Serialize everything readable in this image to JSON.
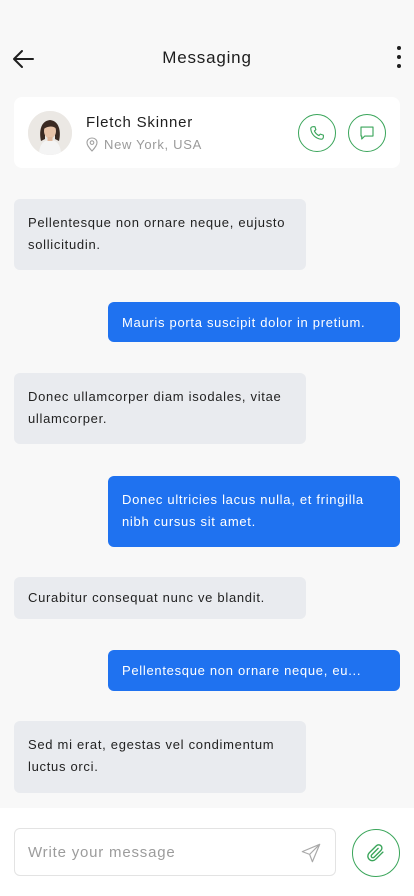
{
  "header": {
    "title": "Messaging"
  },
  "contact": {
    "name": "Fletch Skinner",
    "location": "New York, USA"
  },
  "messages": [
    {
      "direction": "in",
      "text": "Pellentesque non ornare neque, eujusto sollicitudin."
    },
    {
      "direction": "out",
      "text": "Mauris porta suscipit dolor in pretium."
    },
    {
      "direction": "in",
      "text": "Donec ullamcorper diam isodales, vitae ullamcorper."
    },
    {
      "direction": "out",
      "text": "Donec ultricies lacus nulla, et fringilla nibh cursus sit amet."
    },
    {
      "direction": "in",
      "text": "Curabitur consequat nunc ve  blandit."
    },
    {
      "direction": "out",
      "text": "Pellentesque non ornare neque, eu..."
    },
    {
      "direction": "in",
      "text": "Sed mi erat, egestas vel condimentum luctus orci."
    }
  ],
  "composer": {
    "placeholder": "Write your message",
    "value": ""
  },
  "colors": {
    "accent_green": "#3aa55a",
    "outgoing_bubble": "#1f72f0",
    "incoming_bubble": "#e9ebef"
  },
  "icons": {
    "back": "arrow-left-icon",
    "more": "more-vertical-icon",
    "location": "map-pin-icon",
    "call": "phone-icon",
    "chat": "chat-bubble-icon",
    "send": "send-icon",
    "attach": "paperclip-icon"
  }
}
